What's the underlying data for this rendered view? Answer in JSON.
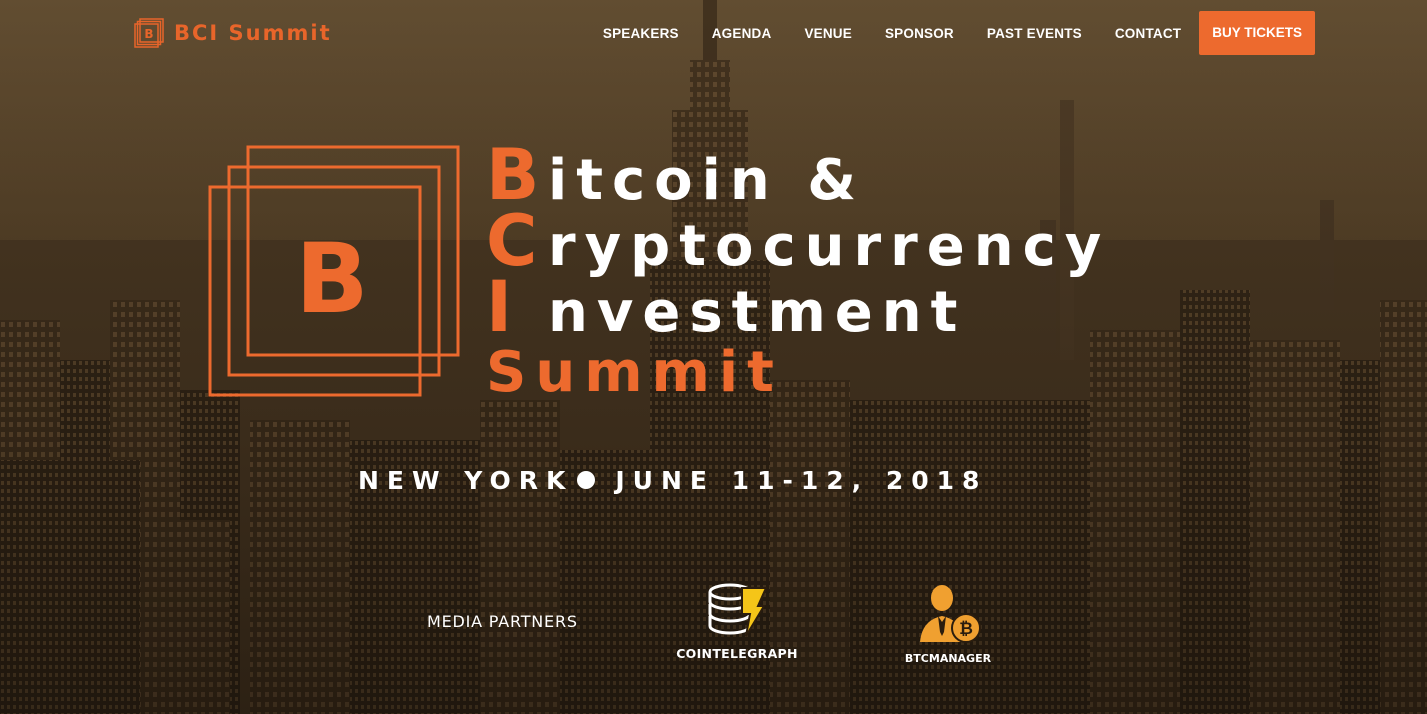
{
  "colors": {
    "accent": "#ed6a2e",
    "text": "#ffffff"
  },
  "nav": {
    "brand_text": "BCI Summit",
    "brand_icon": "b-square-logo-icon",
    "items": [
      {
        "label": "SPEAKERS"
      },
      {
        "label": "AGENDA"
      },
      {
        "label": "VENUE"
      },
      {
        "label": "SPONSOR"
      },
      {
        "label": "PAST EVENTS"
      },
      {
        "label": "CONTACT"
      }
    ],
    "cta_label": "BUY TICKETS"
  },
  "hero": {
    "logo_letter": "B",
    "title_lines": [
      {
        "initial": "B",
        "rest": "itcoin &"
      },
      {
        "initial": "C",
        "rest": "ryptocurrency"
      },
      {
        "initial": "I",
        "rest": "nvestment"
      },
      {
        "initial": "",
        "rest": "Summit"
      }
    ],
    "location": "NEW YORK",
    "dates": "JUNE 11-12, 2018"
  },
  "partners": {
    "label": "MEDIA PARTNERS",
    "items": [
      {
        "name": "COINTELEGRAPH",
        "icon": "cointelegraph-coin-stack-icon"
      },
      {
        "name": "BTCMANAGER",
        "icon": "btcmanager-businessman-bitcoin-icon"
      }
    ]
  }
}
